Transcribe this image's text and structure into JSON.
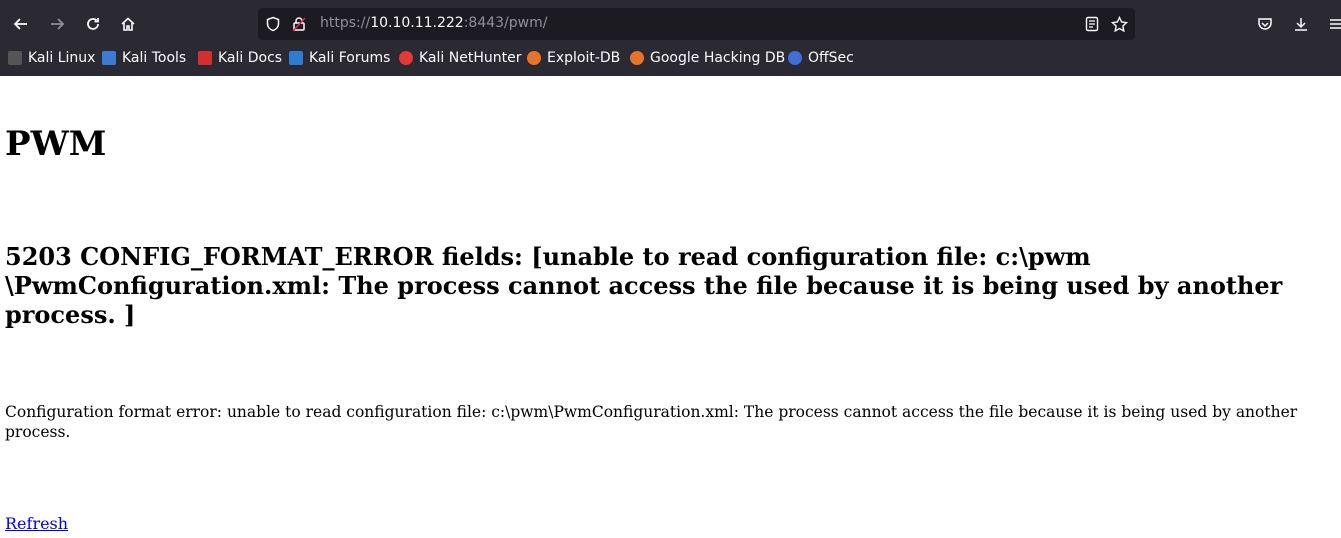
{
  "browser": {
    "url_prefix": "https://",
    "url_host": "10.10.11.222",
    "url_rest": ":8443/pwm/",
    "bookmarks": [
      {
        "label": "Kali Linux",
        "icon": "kali-dragon-icon",
        "color": "#5b5b5b"
      },
      {
        "label": "Kali Tools",
        "icon": "kali-tools-icon",
        "color": "#3b7bd4"
      },
      {
        "label": "Kali Docs",
        "icon": "kali-docs-icon",
        "color": "#d32f2f"
      },
      {
        "label": "Kali Forums",
        "icon": "kali-forums-icon",
        "color": "#2f7ad3"
      },
      {
        "label": "Kali NetHunter",
        "icon": "kali-nethunter-icon",
        "color": "#e53935"
      },
      {
        "label": "Exploit-DB",
        "icon": "exploit-db-icon",
        "color": "#e8742c"
      },
      {
        "label": "Google Hacking DB",
        "icon": "ghdb-icon",
        "color": "#e8742c"
      },
      {
        "label": "OffSec",
        "icon": "offsec-icon",
        "color": "#3f6fd8"
      }
    ]
  },
  "page": {
    "title": "PWM",
    "error_heading": "5203 CONFIG_FORMAT_ERROR fields: [unable to read configuration file: c:\\pwm \\PwmConfiguration.xml: The process cannot access the file because it is being used by another process. ]",
    "error_message": "Configuration format error: unable to read configuration file: c:\\pwm\\PwmConfiguration.xml: The process cannot access the file because it is being used by another process.",
    "refresh_link": "Refresh"
  }
}
